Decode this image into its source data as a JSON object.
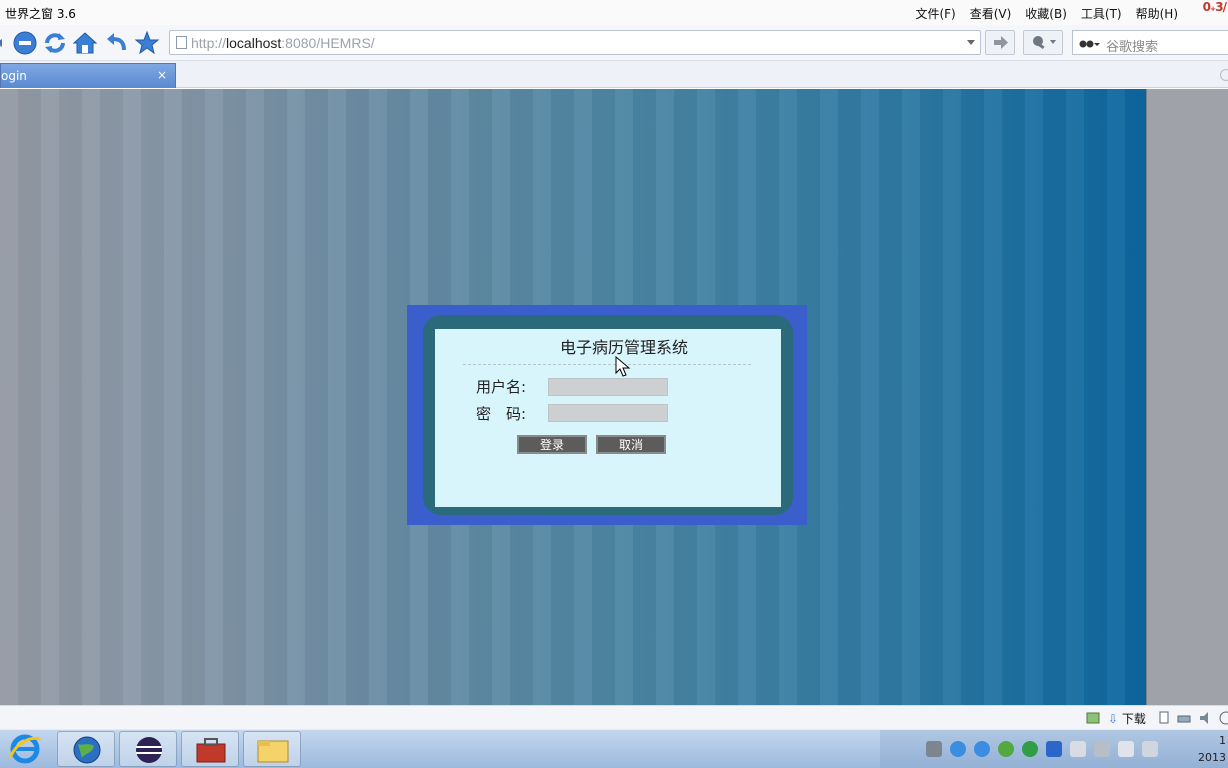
{
  "browser": {
    "title": "世界之窗 3.6",
    "menu": [
      "文件(F)",
      "查看(V)",
      "收藏(B)",
      "工具(T)",
      "帮助(H)"
    ],
    "corner_text": "0₊3/",
    "url_prefix": "http://",
    "url_host": "localhost",
    "url_rest": ":8080/HEMRS/",
    "search_placeholder": "谷歌搜索",
    "tab_label": "ogin",
    "tab_close": "×"
  },
  "login": {
    "title": "电子病历管理系统",
    "username_label": "用户名:",
    "password_label": "密　码:",
    "login_button": "登录",
    "cancel_button": "取消",
    "username_value": "",
    "password_value": ""
  },
  "statusbar": {
    "download_label": "下载"
  },
  "taskbar": {
    "clock_line1": "1",
    "clock_line2": "2013"
  }
}
